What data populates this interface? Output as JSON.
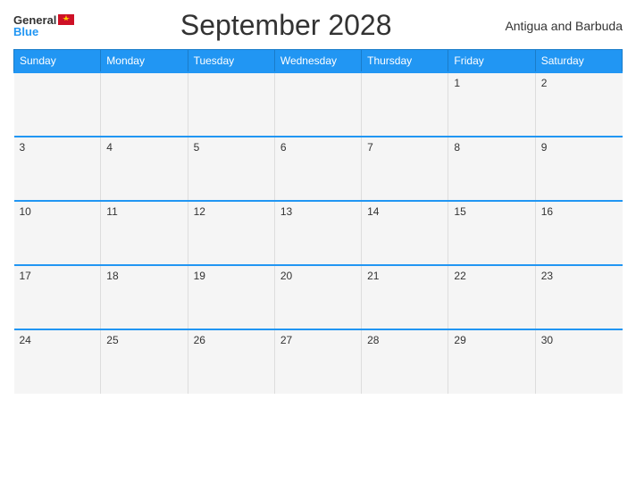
{
  "header": {
    "logo_general": "General",
    "logo_blue": "Blue",
    "title": "September 2028",
    "country": "Antigua and Barbuda"
  },
  "weekdays": [
    "Sunday",
    "Monday",
    "Tuesday",
    "Wednesday",
    "Thursday",
    "Friday",
    "Saturday"
  ],
  "weeks": [
    [
      {
        "day": "",
        "empty": true
      },
      {
        "day": "",
        "empty": true
      },
      {
        "day": "",
        "empty": true
      },
      {
        "day": "",
        "empty": true
      },
      {
        "day": "",
        "empty": true
      },
      {
        "day": "1",
        "empty": false
      },
      {
        "day": "2",
        "empty": false
      }
    ],
    [
      {
        "day": "3",
        "empty": false
      },
      {
        "day": "4",
        "empty": false
      },
      {
        "day": "5",
        "empty": false
      },
      {
        "day": "6",
        "empty": false
      },
      {
        "day": "7",
        "empty": false
      },
      {
        "day": "8",
        "empty": false
      },
      {
        "day": "9",
        "empty": false
      }
    ],
    [
      {
        "day": "10",
        "empty": false
      },
      {
        "day": "11",
        "empty": false
      },
      {
        "day": "12",
        "empty": false
      },
      {
        "day": "13",
        "empty": false
      },
      {
        "day": "14",
        "empty": false
      },
      {
        "day": "15",
        "empty": false
      },
      {
        "day": "16",
        "empty": false
      }
    ],
    [
      {
        "day": "17",
        "empty": false
      },
      {
        "day": "18",
        "empty": false
      },
      {
        "day": "19",
        "empty": false
      },
      {
        "day": "20",
        "empty": false
      },
      {
        "day": "21",
        "empty": false
      },
      {
        "day": "22",
        "empty": false
      },
      {
        "day": "23",
        "empty": false
      }
    ],
    [
      {
        "day": "24",
        "empty": false
      },
      {
        "day": "25",
        "empty": false
      },
      {
        "day": "26",
        "empty": false
      },
      {
        "day": "27",
        "empty": false
      },
      {
        "day": "28",
        "empty": false
      },
      {
        "day": "29",
        "empty": false
      },
      {
        "day": "30",
        "empty": false
      }
    ]
  ]
}
